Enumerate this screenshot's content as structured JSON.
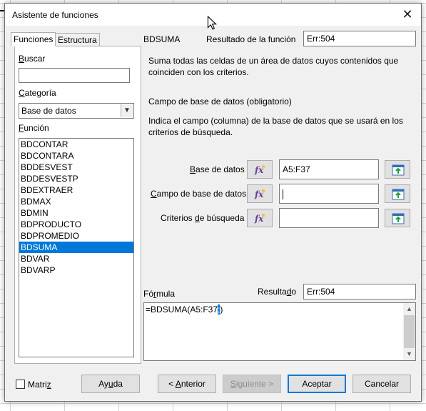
{
  "window": {
    "title": "Asistente de funciones",
    "close_glyph": "✕"
  },
  "tabs": [
    {
      "label": "Funciones",
      "active": true
    },
    {
      "label": "Estructura",
      "active": false
    }
  ],
  "search": {
    "label_key": "B",
    "label_rest": "uscar",
    "value": ""
  },
  "category": {
    "label_key": "C",
    "label_rest": "ategoría",
    "value": "Base de datos"
  },
  "function_list": {
    "label_key": "F",
    "label_rest": "unción",
    "items": [
      "BDCONTAR",
      "BDCONTARA",
      "BDDESVEST",
      "BDDESVESTP",
      "BDEXTRAER",
      "BDMAX",
      "BDMIN",
      "BDPRODUCTO",
      "BDPROMEDIO",
      "BDSUMA",
      "BDVAR",
      "BDVARP"
    ],
    "selected": "BDSUMA"
  },
  "function_header": {
    "name": "BDSUMA",
    "result_label": "Resultado de la función",
    "result_value": "Err:504"
  },
  "description": "Suma todas las celdas de un área de datos cuyos contenidos que coinciden con los criterios.",
  "parameter": {
    "title": "Campo de base de datos (obligatorio)",
    "description": "Indica el campo (columna) de la base de datos que se usará en los criterios de búsqueda."
  },
  "args": [
    {
      "label_pre": "",
      "label_key": "B",
      "label_post": "ase de datos",
      "value": "A5:F37"
    },
    {
      "label_pre": "",
      "label_key": "C",
      "label_post": "ampo de base de datos",
      "value": ""
    },
    {
      "label_pre": "Criterios ",
      "label_key": "d",
      "label_post": "e búsqueda",
      "value": ""
    }
  ],
  "formula": {
    "label_pre": "Fó",
    "label_key": "r",
    "label_post": "mula",
    "text_main": "=BDSUMA(A5:F37",
    "text_selected": ";",
    "text_end": ")"
  },
  "result": {
    "label_pre": "Resulta",
    "label_key": "d",
    "label_post": "o",
    "value": "Err:504"
  },
  "options": {
    "matrix_label_pre": "Matri",
    "matrix_key": "z",
    "matrix_checked": false
  },
  "buttons": {
    "help": {
      "pre": "Ay",
      "key": "u",
      "post": "da"
    },
    "back": {
      "pre": "< ",
      "key": "A",
      "post": "nterior"
    },
    "next": {
      "pre": "",
      "key": "S",
      "post": "iguiente >"
    },
    "ok": "Aceptar",
    "cancel": "Cancelar"
  },
  "icons": {
    "fx": "function-wizard-icon",
    "shrink": "shrink-selection-icon"
  },
  "colors": {
    "selection": "#0078d7",
    "dialog_bg": "#f0f0f0"
  }
}
